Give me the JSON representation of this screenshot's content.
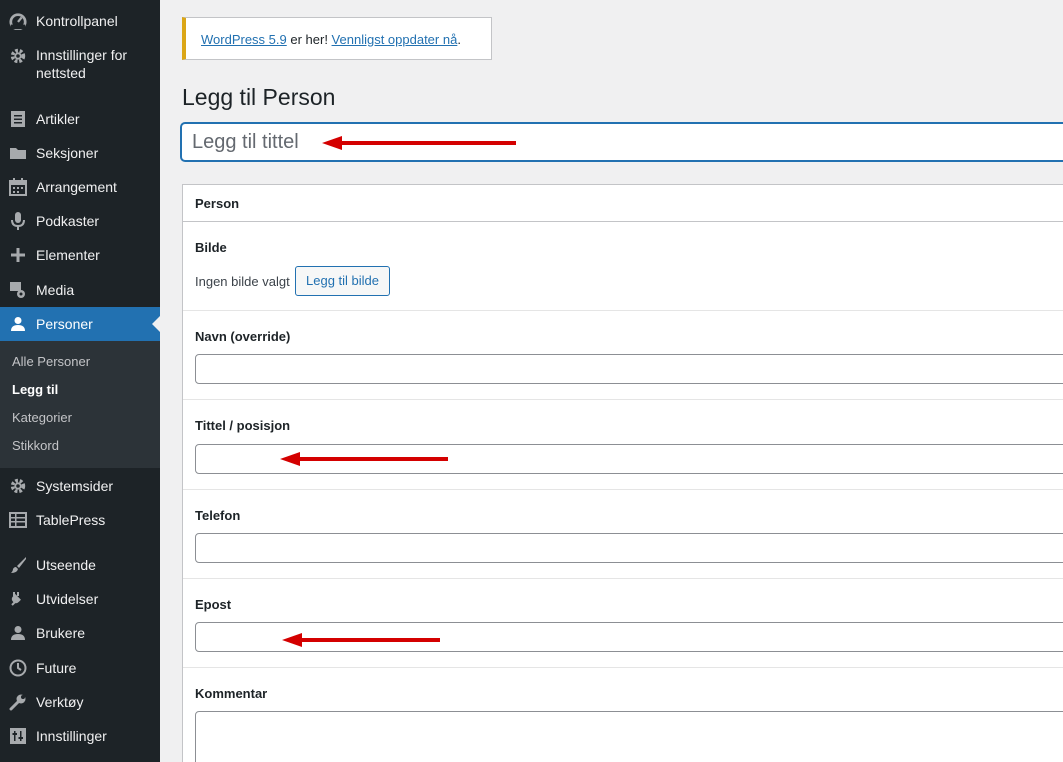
{
  "sidebar": {
    "items": [
      {
        "label": "Kontrollpanel",
        "icon": "dashboard-icon"
      },
      {
        "label": "Innstillinger for nettsted",
        "icon": "gear-icon"
      },
      {
        "label": "Artikler",
        "icon": "posts-icon"
      },
      {
        "label": "Seksjoner",
        "icon": "folder-icon"
      },
      {
        "label": "Arrangement",
        "icon": "calendar-icon"
      },
      {
        "label": "Podkaster",
        "icon": "microphone-icon"
      },
      {
        "label": "Elementer",
        "icon": "plus-icon"
      },
      {
        "label": "Media",
        "icon": "media-icon"
      },
      {
        "label": "Personer",
        "icon": "user-icon"
      },
      {
        "label": "Systemsider",
        "icon": "gear-icon"
      },
      {
        "label": "TablePress",
        "icon": "table-icon"
      },
      {
        "label": "Utseende",
        "icon": "brush-icon"
      },
      {
        "label": "Utvidelser",
        "icon": "plugin-icon"
      },
      {
        "label": "Brukere",
        "icon": "user-icon"
      },
      {
        "label": "Future",
        "icon": "clock-icon"
      },
      {
        "label": "Verktøy",
        "icon": "wrench-icon"
      },
      {
        "label": "Innstillinger",
        "icon": "settings-icon"
      }
    ],
    "submenu": [
      "Alle Personer",
      "Legg til",
      "Kategorier",
      "Stikkord"
    ]
  },
  "notice": {
    "link1": "WordPress 5.9",
    "text": " er her! ",
    "link2": "Vennligst oppdater nå",
    "end": "."
  },
  "page_title": "Legg til Person",
  "title_placeholder": "Legg til tittel",
  "metabox": {
    "title": "Person",
    "image_label": "Bilde",
    "no_image": "Ingen bilde valgt",
    "add_image": "Legg til bilde",
    "name_label": "Navn (override)",
    "position_label": "Tittel / posisjon",
    "phone_label": "Telefon",
    "email_label": "Epost",
    "comment_label": "Kommentar"
  },
  "colors": {
    "sidebar_bg": "#1d2327",
    "current_bg": "#2271b1",
    "arrow": "#d40000"
  }
}
